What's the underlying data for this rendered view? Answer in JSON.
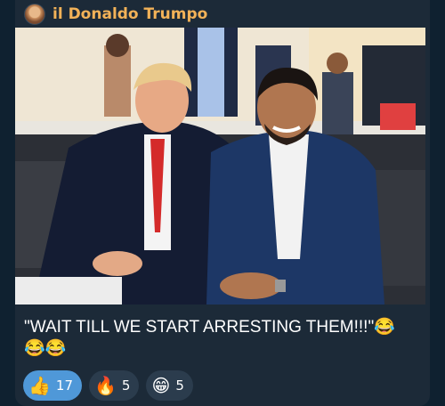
{
  "message": {
    "sender_name": "il Donaldo Trumpo",
    "caption": "\"WAIT TILL WE START ARRESTING THEM!!!\"😂😂😂"
  },
  "reactions": [
    {
      "emoji": "👍",
      "count": "17",
      "selected": true
    },
    {
      "emoji": "🔥",
      "count": "5",
      "selected": false
    },
    {
      "emoji": "😁",
      "count": "5",
      "selected": false
    }
  ],
  "colors": {
    "sender": "#f2b258",
    "bubble": "#1c2a38",
    "reaction_active": "#4f98d8",
    "reaction_inactive": "#2b3c4d"
  }
}
